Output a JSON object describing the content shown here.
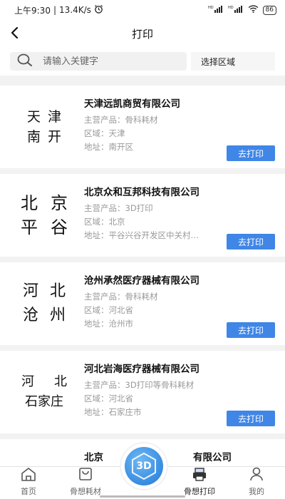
{
  "status": {
    "time": "上午9:30",
    "speed": "13.4K/s",
    "signal1": "HD",
    "signal2": "HD",
    "battery": "86"
  },
  "nav": {
    "title": "打印"
  },
  "search": {
    "placeholder": "请输入关键字",
    "region_label": "选择区域"
  },
  "companies": [
    {
      "logo": [
        "天",
        "津",
        "南",
        "开"
      ],
      "name": "天津远凯商贸有限公司",
      "product": "主营产品：骨科耗材",
      "region": "区域：天津",
      "address": "地址：南开区",
      "button": "去打印"
    },
    {
      "logo": [
        "北",
        "京",
        "平",
        "谷"
      ],
      "name": "北京众和互邦科技有限公司",
      "product": "主营产品：3D打印",
      "region": "区域：北京",
      "address": "地址：平谷兴谷开发区中关村…",
      "button": "去打印"
    },
    {
      "logo": [
        "河",
        "北",
        "沧",
        "州"
      ],
      "name": "沧州承然医疗器械有限公司",
      "product": "主营产品：骨科耗材",
      "region": "区域：河北省",
      "address": "地址：沧州市",
      "button": "去打印"
    },
    {
      "logo": [
        "河",
        "北",
        "石家庄"
      ],
      "name": "河北岩海医疗器械有限公司",
      "product": "主营产品：3D打印等骨科耗材",
      "region": "区域：河北省",
      "address": "地址：石家庄市",
      "button": "去打印"
    },
    {
      "name_left": "北京",
      "name_right": "有限公司"
    }
  ],
  "tabs": {
    "home": "首页",
    "materials": "骨想耗材",
    "center": "3D",
    "print": "骨想打印",
    "mine": "我的"
  },
  "colors": {
    "accent": "#3f86e6",
    "fab": "#2b86e0"
  }
}
